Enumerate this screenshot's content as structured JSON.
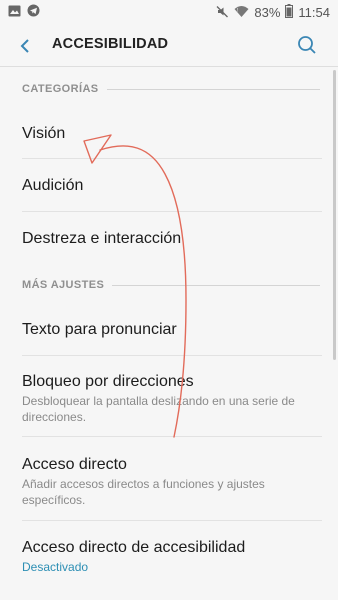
{
  "status_bar": {
    "battery": "83%",
    "time": "11:54",
    "icons": [
      "gallery-icon",
      "telegram-icon",
      "mute-icon",
      "wifi-icon",
      "battery-icon"
    ]
  },
  "app_bar": {
    "title": "ACCESIBILIDAD",
    "back_icon": "back-arrow-icon",
    "search_icon": "search-icon"
  },
  "sections": [
    {
      "header": "CATEGORÍAS",
      "items": [
        {
          "title": "Visión"
        },
        {
          "title": "Audición"
        },
        {
          "title": "Destreza e interacción"
        }
      ]
    },
    {
      "header": "MÁS AJUSTES",
      "items": [
        {
          "title": "Texto para pronunciar"
        },
        {
          "title": "Bloqueo por direcciones",
          "summary": "Desbloquear la pantalla deslizando en una serie de direcciones."
        },
        {
          "title": "Acceso directo",
          "summary": "Añadir accesos directos a funciones y ajustes específicos."
        },
        {
          "title": "Acceso directo de accesibilidad",
          "summary": "Desactivado"
        }
      ]
    }
  ],
  "colors": {
    "background": "#f6f6f6",
    "accent": "#2d8fb4",
    "annotation": "#e26b5a"
  }
}
